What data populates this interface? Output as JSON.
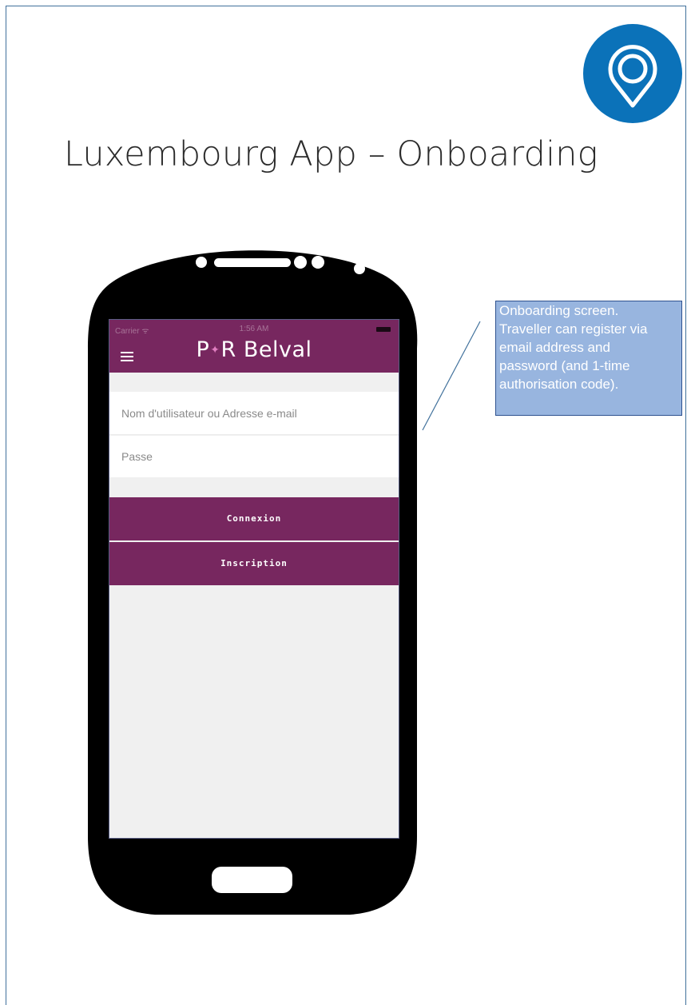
{
  "slide": {
    "title": "Luxembourg App – Onboarding",
    "pin_icon": "location-pin-icon",
    "accent_color": "#0b72b9"
  },
  "phone": {
    "status_bar": {
      "carrier": "Carrier ᯤ",
      "time": "1:56 AM"
    },
    "app": {
      "menu_icon": "hamburger-menu-icon",
      "brand_left": "P",
      "brand_separator": "✦",
      "brand_right": "R Belval",
      "brand_color": "#77275f",
      "username_placeholder": "Nom d'utilisateur ou Adresse e-mail",
      "password_placeholder": "Passe",
      "login_label": "Connexion",
      "register_label": "Inscription"
    }
  },
  "callout": {
    "lines": [
      "Onboarding screen.",
      "Traveller can register via",
      "email address and",
      "password (and 1-time",
      "authorisation code)."
    ]
  }
}
